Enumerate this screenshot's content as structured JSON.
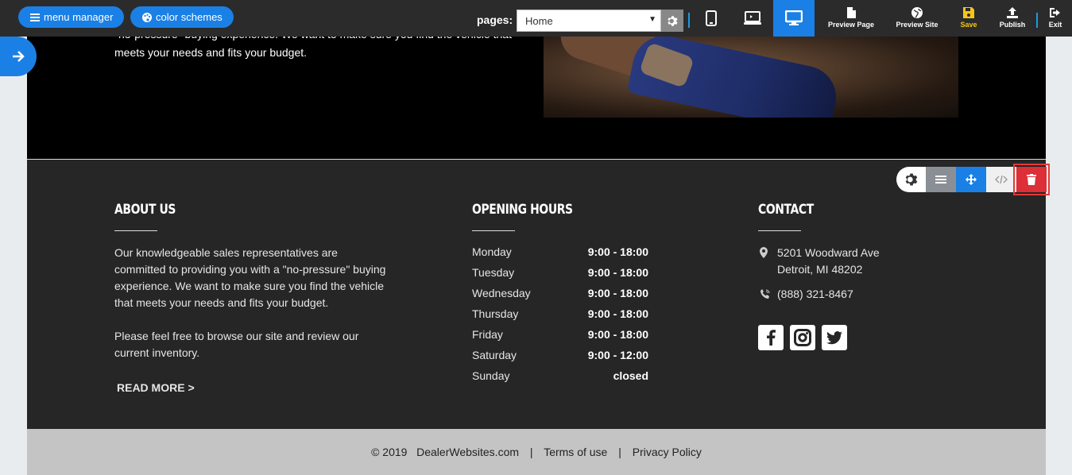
{
  "toolbar": {
    "menu_manager": "menu manager",
    "color_schemes": "color schemes",
    "pages_label": "pages:",
    "pages_selected": "Home",
    "preview_page": "Preview Page",
    "preview_site": "Preview Site",
    "save": "Save",
    "publish": "Publish",
    "exit": "Exit",
    "accent": "#1a80e5",
    "save_color": "#f5c518"
  },
  "hero": {
    "text": "\"no-pressure\" buying experience. We want to make sure you find the vehicle that meets your needs and fits your budget."
  },
  "footer": {
    "about": {
      "title": "ABOUT US",
      "paragraph1": "Our knowledgeable sales representatives are committed to providing you with a \"no-pressure\" buying experience. We want to make sure you find the vehicle that meets your needs and fits your budget.",
      "paragraph2": "Please feel free to browse our site and review our current inventory.",
      "read_more": "READ MORE >"
    },
    "hours": {
      "title": "OPENING HOURS",
      "rows": [
        {
          "day": "Monday",
          "time": "9:00 - 18:00"
        },
        {
          "day": "Tuesday",
          "time": "9:00 - 18:00"
        },
        {
          "day": "Wednesday",
          "time": "9:00 - 18:00"
        },
        {
          "day": "Thursday",
          "time": "9:00 - 18:00"
        },
        {
          "day": "Friday",
          "time": "9:00 - 18:00"
        },
        {
          "day": "Saturday",
          "time": "9:00 - 12:00"
        },
        {
          "day": "Sunday",
          "time": "closed"
        }
      ]
    },
    "contact": {
      "title": "CONTACT",
      "address_line1": "5201 Woodward Ave",
      "address_line2": "Detroit, MI 48202",
      "phone": "(888) 321-8467"
    },
    "section_tools": [
      "gear-icon",
      "list-icon",
      "move-icon",
      "code-icon",
      "trash-icon"
    ]
  },
  "bottom": {
    "copyright": "© 2019   DealerWebsites.com",
    "terms": "Terms of use",
    "privacy": "Privacy Policy",
    "separator": "|"
  }
}
